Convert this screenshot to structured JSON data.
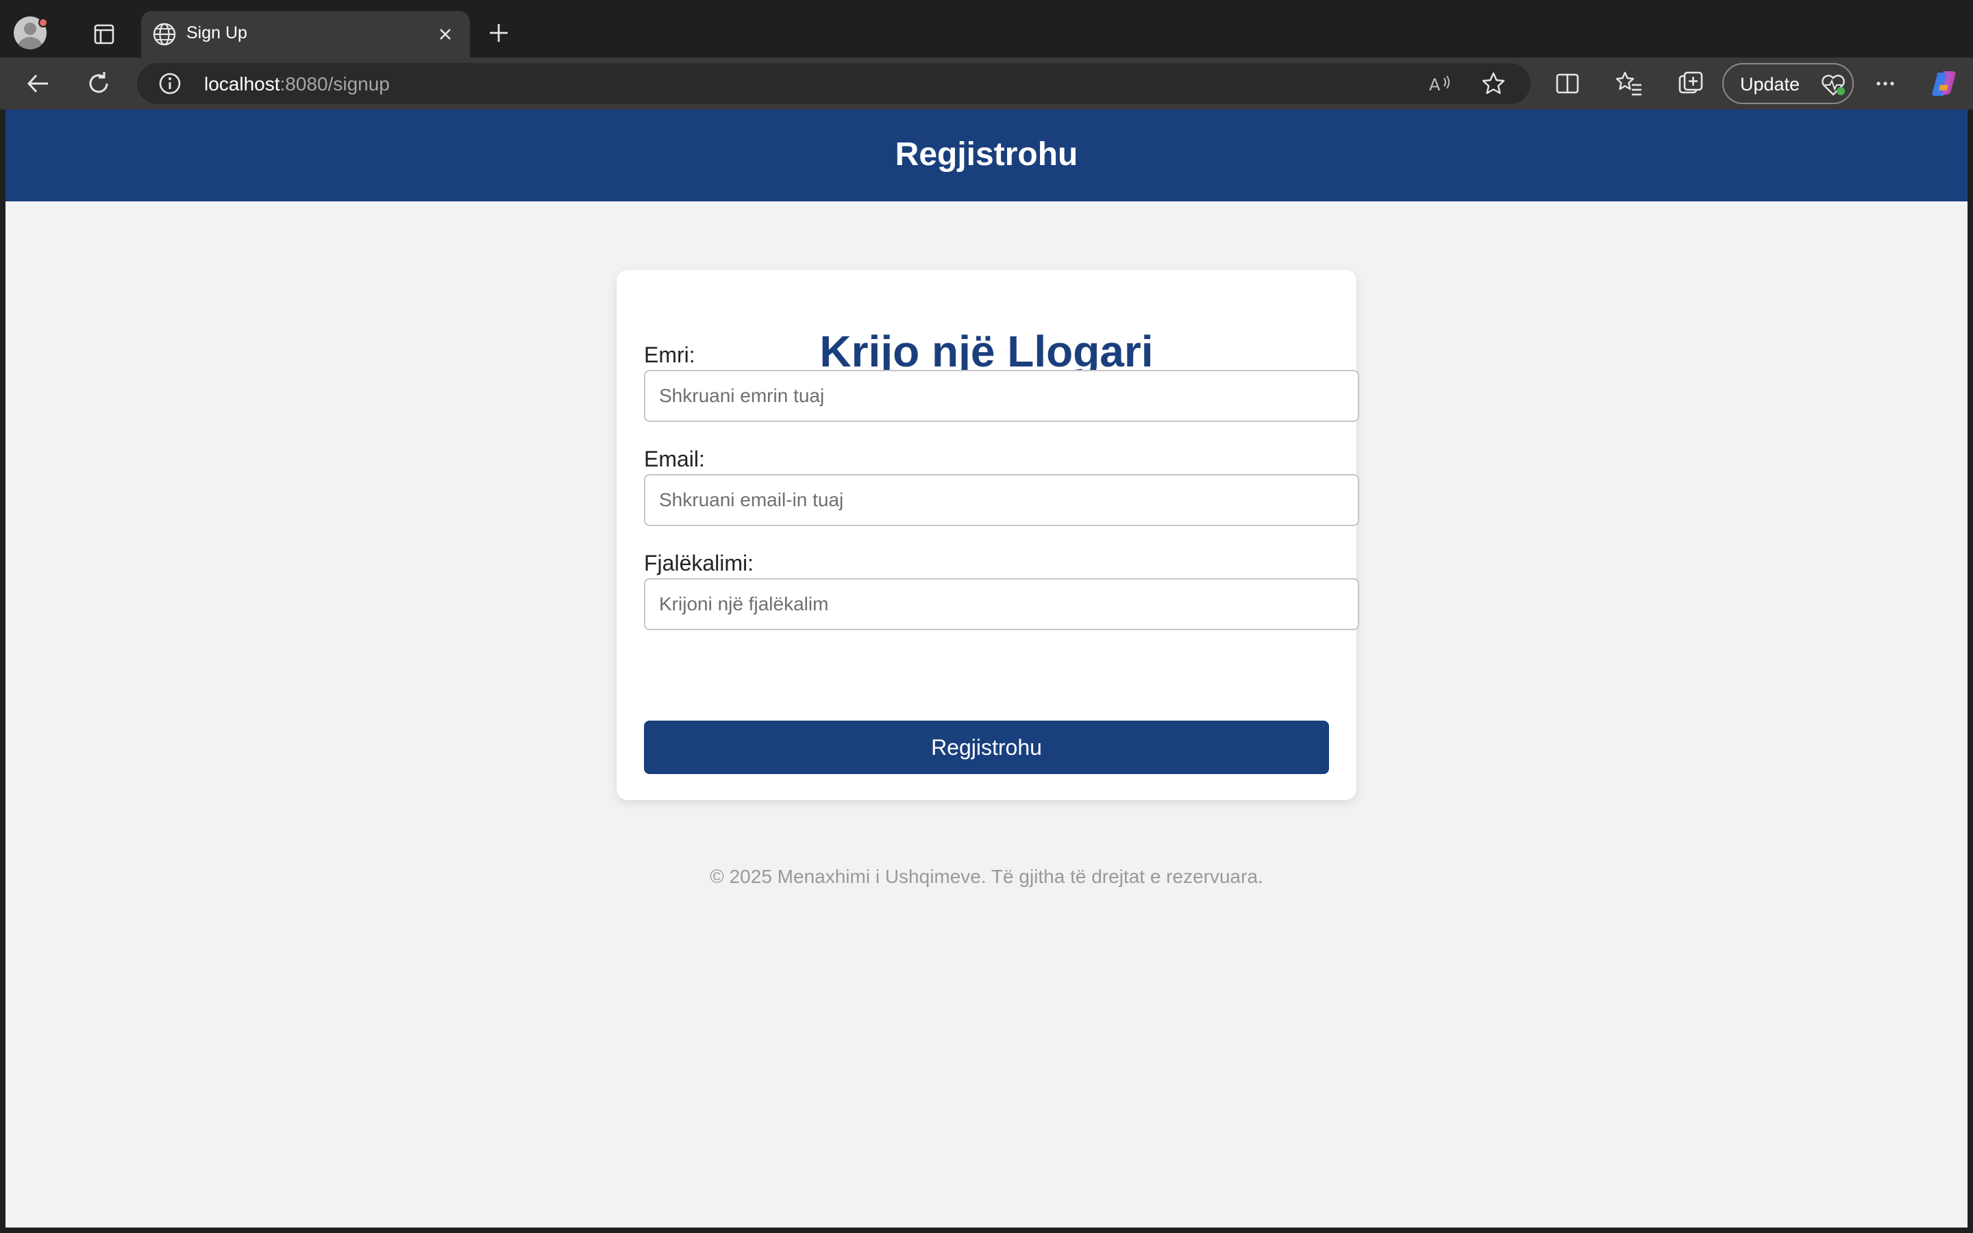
{
  "browser": {
    "tab_title": "Sign Up",
    "url_host": "localhost",
    "url_path": ":8080/signup",
    "update_label": "Update"
  },
  "header": {
    "title": "Regjistrohu"
  },
  "form": {
    "title": "Krijo një Llogari",
    "name_label": "Emri:",
    "name_placeholder": "Shkruani emrin tuaj",
    "email_label": "Email:",
    "email_placeholder": "Shkruani email-in tuaj",
    "password_label": "Fjalëkalimi:",
    "password_placeholder": "Krijoni një fjalëkalim",
    "submit_label": "Regjistrohu"
  },
  "footer": {
    "text": "© 2025 Menaxhimi i Ushqimeve. Të gjitha të drejtat e rezervuara."
  },
  "colors": {
    "brand": "#1a3f7d",
    "page_bg": "#f2f2f2",
    "browser_chrome": "#1f1f1f"
  }
}
